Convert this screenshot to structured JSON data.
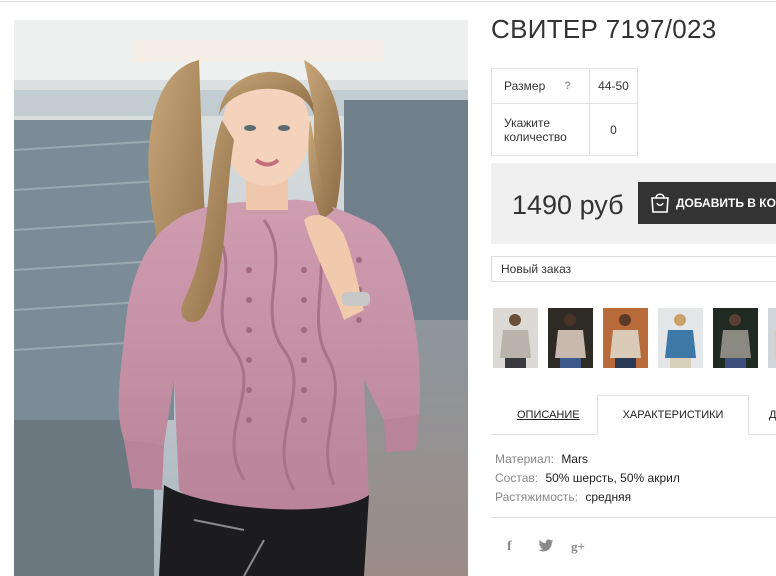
{
  "product": {
    "title": "СВИТЕР 7197/023",
    "image_alt": "pink-knit-sweater-photo"
  },
  "options": {
    "size_label": "Размер",
    "size_help": "?",
    "size_value": "44-50",
    "qty_label": "Укажите количество",
    "qty_value": "0"
  },
  "purchase": {
    "price": "1490 руб",
    "add_label": "ДОБАВИТЬ В КОРЗИНУ",
    "order_select": "Новый заказ"
  },
  "gallery": {
    "thumbs": [
      {
        "color": "#b9b3ac"
      },
      {
        "color": "#c8b8ae"
      },
      {
        "color": "#d9cbb7"
      },
      {
        "color": "#3e78a6"
      },
      {
        "color": "#8c8a80"
      },
      {
        "color": "#d2cdc7"
      }
    ]
  },
  "tabs": {
    "description": "ОПИСАНИЕ",
    "characteristics": "ХАРАКТЕРИСТИКИ",
    "next": "Д"
  },
  "specs": {
    "material_key": "Материал:",
    "material_val": "Mars",
    "composition_key": "Состав:",
    "composition_val": "50% шерсть, 50% акрил",
    "stretch_key": "Растяжимость:",
    "stretch_val": "средняя"
  },
  "share": {
    "facebook": "f",
    "twitter": "twitter",
    "google": "g+"
  },
  "colors": {
    "button_bg": "#333333",
    "price_bg": "#f0f0f0",
    "sweater": "#c48ea3"
  }
}
